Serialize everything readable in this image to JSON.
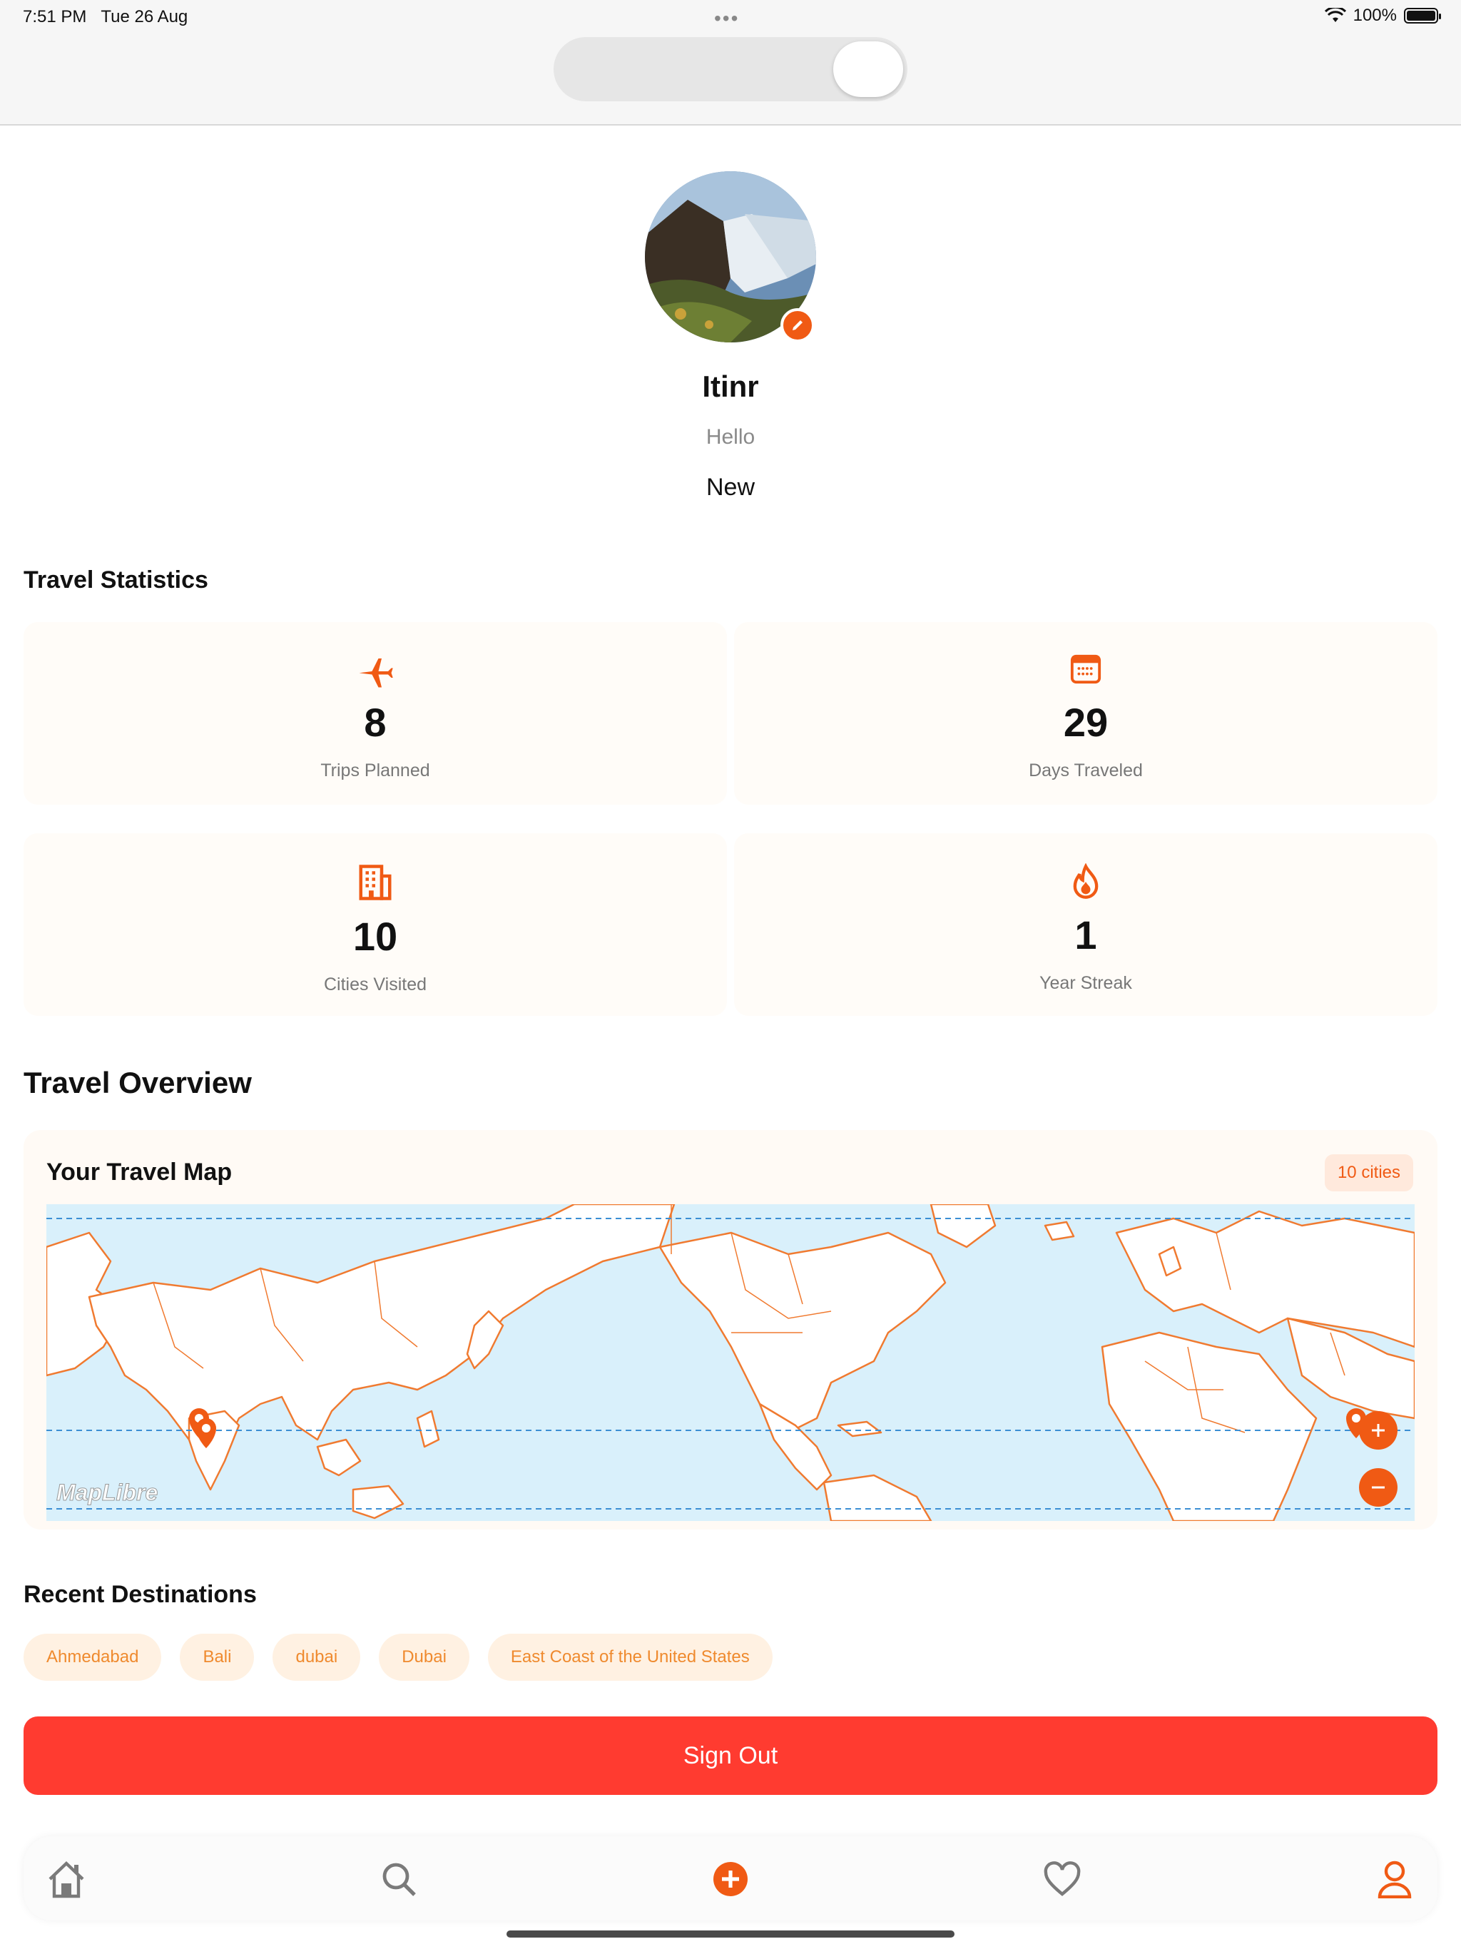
{
  "status_bar": {
    "time": "7:51 PM",
    "date": "Tue 26 Aug",
    "battery": "100%"
  },
  "profile": {
    "name": "Itinr",
    "bio": "Hello",
    "status": "New"
  },
  "stats": {
    "title": "Travel Statistics",
    "items": [
      {
        "icon": "airplane-icon",
        "value": "8",
        "label": "Trips Planned"
      },
      {
        "icon": "calendar-icon",
        "value": "29",
        "label": "Days Traveled"
      },
      {
        "icon": "building-icon",
        "value": "10",
        "label": "Cities Visited"
      },
      {
        "icon": "flame-icon",
        "value": "1",
        "label": "Year Streak"
      }
    ]
  },
  "overview": {
    "title": "Travel Overview",
    "map_title": "Your Travel Map",
    "city_count": "10 cities",
    "attribution": "MapLibre"
  },
  "recent": {
    "title": "Recent Destinations",
    "chips": [
      "Ahmedabad",
      "Bali",
      "dubai",
      "Dubai",
      "East Coast of the United States"
    ]
  },
  "sign_out_label": "Sign Out",
  "colors": {
    "accent": "#f05a14",
    "danger": "#ff3b30",
    "map_water": "#d9f0fb",
    "map_border": "#f07a30"
  },
  "tab_bar": [
    "home-icon",
    "search-icon",
    "add-icon",
    "heart-icon",
    "profile-icon"
  ]
}
